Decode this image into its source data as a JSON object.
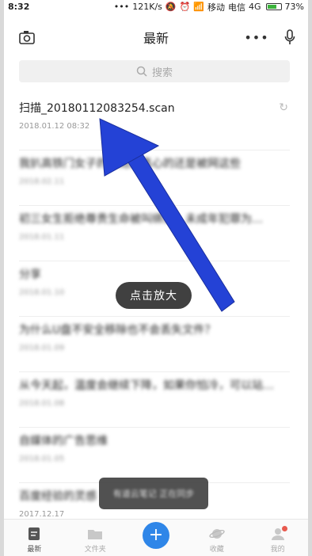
{
  "status_bar": {
    "time": "8:32",
    "net_speed": "121K/s",
    "carrier1": "移动",
    "carrier2": "电信",
    "network": "4G",
    "battery": "73%"
  },
  "header": {
    "title": "最新"
  },
  "search": {
    "placeholder": "搜索"
  },
  "notes": [
    {
      "title": "扫描_20180112083254.scan",
      "date": "2018.01.12 08:32"
    },
    {
      "title": "我扒高铁门女子的…她最真心的还是被网这些",
      "date": "2018.02.11"
    },
    {
      "title": "初三女生拒绝尊贵生命被叫绑架，未成年犯罪为…",
      "date": "2018.01.11"
    },
    {
      "title": "分享",
      "date": "2018.01.10"
    },
    {
      "title": "为什么U盘不安全移除也不会丢失文件？",
      "date": "2018.01.09"
    },
    {
      "title": "从今天起，温度会继续下降，如果你怕冷，可以站…",
      "date": "2018.01.08"
    },
    {
      "title": "自媒体的广告思维",
      "date": "2018.01.05"
    },
    {
      "title": "百度经验的灵感",
      "date": "2017.12.17"
    }
  ],
  "overlay": {
    "zoom_label": "点击放大"
  },
  "toast": {
    "text": "有道云笔记 正在同步"
  },
  "tabbar": {
    "tabs": [
      {
        "label": "最新"
      },
      {
        "label": "文件夹"
      },
      {
        "label": "+"
      },
      {
        "label": "收藏"
      },
      {
        "label": "我的"
      }
    ]
  },
  "colors": {
    "accent": "#2f86e8",
    "arrow": "#2442d6",
    "badge": "#e85a4f"
  }
}
